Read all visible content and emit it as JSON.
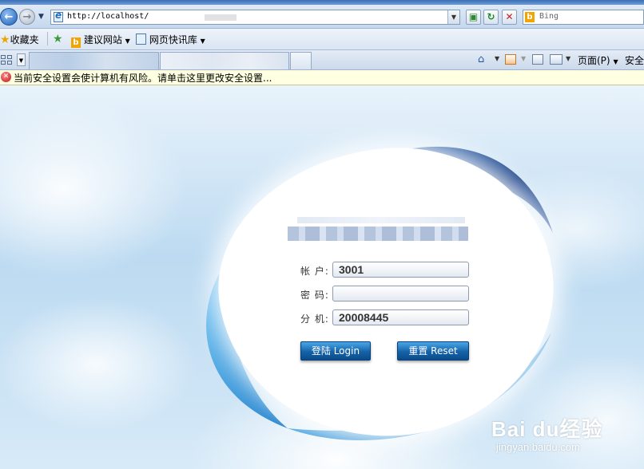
{
  "browser": {
    "address_url": "http://localhost/",
    "search_placeholder": "Bing",
    "favorites_label": "收藏夹",
    "suggested_sites_label": "建议网站",
    "web_slice_label": "网页快讯库",
    "page_menu_label": "页面(P)",
    "safety_menu_label": "安全",
    "infobar_text": "当前安全设置会使计算机有风险。请单击这里更改安全设置..."
  },
  "login": {
    "account_label": "帐 户:",
    "account_value": "3001",
    "password_label": "密 码:",
    "password_value": "",
    "extension_label": "分 机:",
    "extension_value": "20008445",
    "login_button": "登陆 Login",
    "reset_button": "重置 Reset"
  },
  "watermark": {
    "brand": "Bai du经验",
    "site": "jingyan.baidu.com"
  },
  "colors": {
    "swoosh_dark": "#1d4f9a",
    "swoosh_light": "#3fa2e3",
    "button_blue": "#1561a8",
    "infobar_bg": "#ffffe1"
  }
}
